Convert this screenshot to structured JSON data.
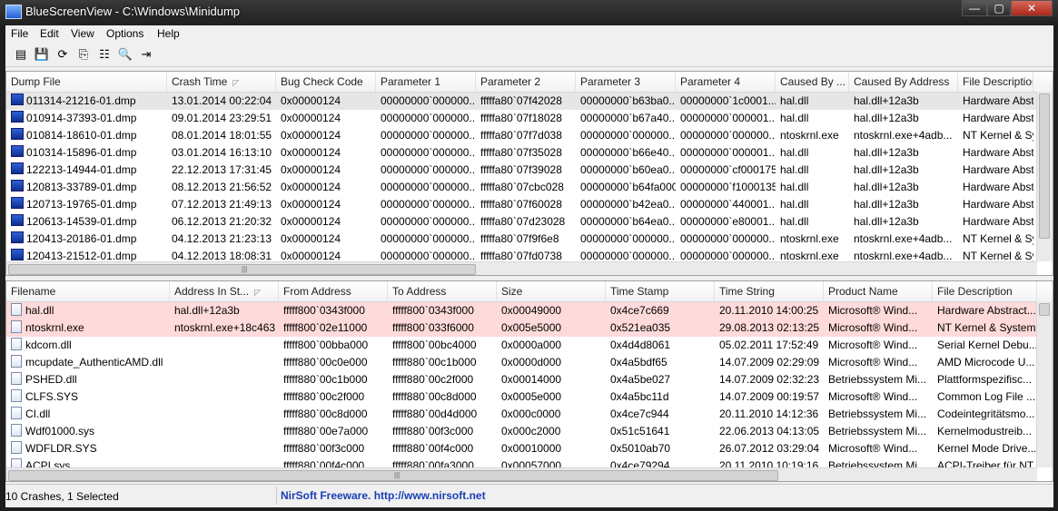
{
  "window": {
    "title": "BlueScreenView  -  C:\\Windows\\Minidump"
  },
  "titlebar_buttons": {
    "minimize": "—",
    "maximize": "▢",
    "close": "✕"
  },
  "menu": [
    "File",
    "Edit",
    "View",
    "Options",
    "Help"
  ],
  "toolbar": [
    {
      "name": "html-report-icon",
      "glyph": "▤"
    },
    {
      "name": "save-icon",
      "glyph": "💾"
    },
    {
      "name": "refresh-icon",
      "glyph": "⟳"
    },
    {
      "name": "copy-icon",
      "glyph": "⎘"
    },
    {
      "name": "properties-icon",
      "glyph": "☷"
    },
    {
      "name": "find-icon",
      "glyph": "🔍"
    },
    {
      "name": "exit-icon",
      "glyph": "⇥"
    }
  ],
  "crash_list": {
    "columns": [
      "Dump File",
      "Crash Time",
      "Bug Check Code",
      "Parameter 1",
      "Parameter 2",
      "Parameter 3",
      "Parameter 4",
      "Caused By ...",
      "Caused By Address",
      "File Description"
    ],
    "sorted_column_glyph": "◸",
    "rows": [
      [
        "011314-21216-01.dmp",
        "13.01.2014 00:22:04",
        "0x00000124",
        "00000000`000000...",
        "fffffa80`07f42028",
        "00000000`b63ba0...",
        "00000000`1c0001...",
        "hal.dll",
        "hal.dll+12a3b",
        "Hardware Abstr"
      ],
      [
        "010914-37393-01.dmp",
        "09.01.2014 23:29:51",
        "0x00000124",
        "00000000`000000...",
        "fffffa80`07f18028",
        "00000000`b67a40...",
        "00000000`000001...",
        "hal.dll",
        "hal.dll+12a3b",
        "Hardware Abstr"
      ],
      [
        "010814-18610-01.dmp",
        "08.01.2014 18:01:55",
        "0x00000124",
        "00000000`000000...",
        "fffffa80`07f7d038",
        "00000000`000000...",
        "00000000`000000...",
        "ntoskrnl.exe",
        "ntoskrnl.exe+4adb...",
        "NT Kernel & Sy"
      ],
      [
        "010314-15896-01.dmp",
        "03.01.2014 16:13:10",
        "0x00000124",
        "00000000`000000...",
        "fffffa80`07f35028",
        "00000000`b66e40...",
        "00000000`000001...",
        "hal.dll",
        "hal.dll+12a3b",
        "Hardware Abstr"
      ],
      [
        "122213-14944-01.dmp",
        "22.12.2013 17:31:45",
        "0x00000124",
        "00000000`000000...",
        "fffffa80`07f39028",
        "00000000`b60ea0...",
        "00000000`cf000175",
        "hal.dll",
        "hal.dll+12a3b",
        "Hardware Abstr"
      ],
      [
        "120813-33789-01.dmp",
        "08.12.2013 21:56:52",
        "0x00000124",
        "00000000`000000...",
        "fffffa80`07cbc028",
        "00000000`b64fa000",
        "00000000`f1000135",
        "hal.dll",
        "hal.dll+12a3b",
        "Hardware Abstr"
      ],
      [
        "120713-19765-01.dmp",
        "07.12.2013 21:49:13",
        "0x00000124",
        "00000000`000000...",
        "fffffa80`07f60028",
        "00000000`b42ea0...",
        "00000000`440001...",
        "hal.dll",
        "hal.dll+12a3b",
        "Hardware Abstr"
      ],
      [
        "120613-14539-01.dmp",
        "06.12.2013 21:20:32",
        "0x00000124",
        "00000000`000000...",
        "fffffa80`07d23028",
        "00000000`b64ea0...",
        "00000000`e80001...",
        "hal.dll",
        "hal.dll+12a3b",
        "Hardware Abstr"
      ],
      [
        "120413-20186-01.dmp",
        "04.12.2013 21:23:13",
        "0x00000124",
        "00000000`000000...",
        "fffffa80`07f9f6e8",
        "00000000`000000...",
        "00000000`000000...",
        "ntoskrnl.exe",
        "ntoskrnl.exe+4adb...",
        "NT Kernel & Sy"
      ],
      [
        "120413-21512-01.dmp",
        "04.12.2013 18:08:31",
        "0x00000124",
        "00000000`000000...",
        "fffffa80`07fd0738",
        "00000000`000000...",
        "00000000`000000...",
        "ntoskrnl.exe",
        "ntoskrnl.exe+4adb...",
        "NT Kernel & Sy"
      ]
    ]
  },
  "module_list": {
    "columns": [
      "Filename",
      "Address In St...",
      "From Address",
      "To Address",
      "Size",
      "Time Stamp",
      "Time String",
      "Product Name",
      "File Description"
    ],
    "sorted_column_glyph": "◸",
    "rows": [
      [
        "hal.dll",
        "hal.dll+12a3b",
        "fffff800`0343f000",
        "fffff800`0343f000",
        "0x00049000",
        "0x4ce7c669",
        "20.11.2010 14:00:25",
        "Microsoft® Wind...",
        "Hardware Abstract..."
      ],
      [
        "ntoskrnl.exe",
        "ntoskrnl.exe+18c463",
        "fffff800`02e11000",
        "fffff800`033f6000",
        "0x005e5000",
        "0x521ea035",
        "29.08.2013 02:13:25",
        "Microsoft® Wind...",
        "NT Kernel & System"
      ],
      [
        "kdcom.dll",
        "",
        "fffff800`00bba000",
        "fffff800`00bc4000",
        "0x0000a000",
        "0x4d4d8061",
        "05.02.2011 17:52:49",
        "Microsoft® Wind...",
        "Serial Kernel Debu..."
      ],
      [
        "mcupdate_AuthenticAMD.dll",
        "",
        "fffff880`00c0e000",
        "fffff880`00c1b000",
        "0x0000d000",
        "0x4a5bdf65",
        "14.07.2009 02:29:09",
        "Microsoft® Wind...",
        "AMD Microcode U..."
      ],
      [
        "PSHED.dll",
        "",
        "fffff880`00c1b000",
        "fffff880`00c2f000",
        "0x00014000",
        "0x4a5be027",
        "14.07.2009 02:32:23",
        "Betriebssystem Mi...",
        "Plattformspezifisc..."
      ],
      [
        "CLFS.SYS",
        "",
        "fffff880`00c2f000",
        "fffff880`00c8d000",
        "0x0005e000",
        "0x4a5bc11d",
        "14.07.2009 00:19:57",
        "Microsoft® Wind...",
        "Common Log File ..."
      ],
      [
        "CI.dll",
        "",
        "fffff880`00c8d000",
        "fffff880`00d4d000",
        "0x000c0000",
        "0x4ce7c944",
        "20.11.2010 14:12:36",
        "Betriebssystem Mi...",
        "Codeintegritätsmo..."
      ],
      [
        "Wdf01000.sys",
        "",
        "fffff880`00e7a000",
        "fffff880`00f3c000",
        "0x000c2000",
        "0x51c51641",
        "22.06.2013 04:13:05",
        "Betriebssystem Mi...",
        "Kernelmodustreib..."
      ],
      [
        "WDFLDR.SYS",
        "",
        "fffff880`00f3c000",
        "fffff880`00f4c000",
        "0x00010000",
        "0x5010ab70",
        "26.07.2012 03:29:04",
        "Microsoft® Wind...",
        "Kernel Mode Drive..."
      ],
      [
        "ACPI.sys",
        "",
        "fffff880`00f4c000",
        "fffff880`00fa3000",
        "0x00057000",
        "0x4ce79294",
        "20.11.2010 10:19:16",
        "Betriebssystem Mi...",
        "ACPI-Treiber für NT"
      ]
    ]
  },
  "status": {
    "summary": "10 Crashes, 1 Selected",
    "link": "NirSoft Freeware.  http://www.nirsoft.net"
  },
  "scroll_grip": "|||"
}
